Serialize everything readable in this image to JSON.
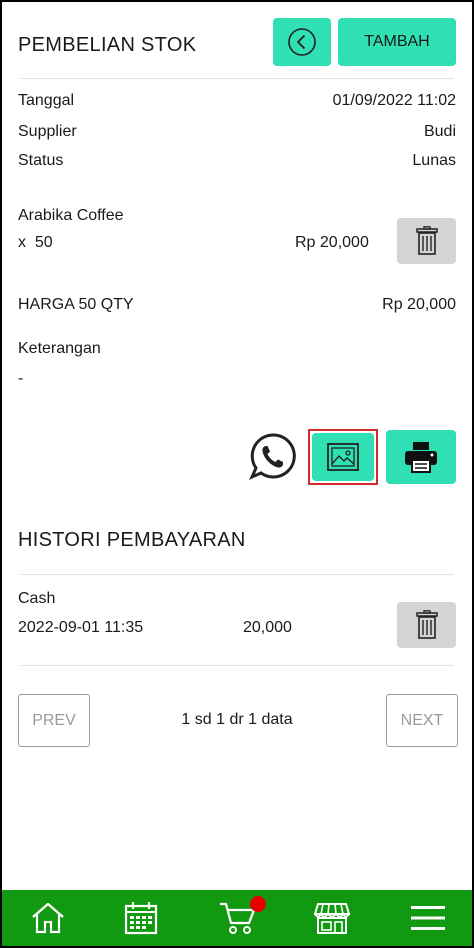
{
  "header": {
    "title": "PEMBELIAN STOK",
    "tambah_label": "TAMBAH"
  },
  "info": [
    {
      "label": "Tanggal",
      "value": "01/09/2022 11:02"
    },
    {
      "label": "Supplier",
      "value": "Budi"
    },
    {
      "label": "Status",
      "value": "Lunas"
    }
  ],
  "item": {
    "name": "Arabika Coffee",
    "qty": "x  50",
    "price": "Rp 20,000"
  },
  "summary": {
    "label": "HARGA 50 QTY",
    "value": "Rp 20,000"
  },
  "note": {
    "label": "Keterangan",
    "value": "-"
  },
  "history": {
    "title": "HISTORI PEMBAYARAN",
    "rows": [
      {
        "method": "Cash",
        "datetime": "2022-09-01 11:35",
        "amount": "20,000"
      }
    ]
  },
  "pagination": {
    "prev": "PREV",
    "next": "NEXT",
    "info": "1 sd 1 dr 1 data"
  },
  "colors": {
    "accent": "#2fe0b4",
    "nav": "#119a11",
    "badge": "#e60000",
    "highlight": "#d22b2b"
  },
  "icons": [
    "back-arrow-icon",
    "trash-icon",
    "whatsapp-icon",
    "image-icon",
    "printer-icon",
    "home-icon",
    "calendar-icon",
    "cart-icon",
    "store-icon",
    "menu-icon"
  ]
}
